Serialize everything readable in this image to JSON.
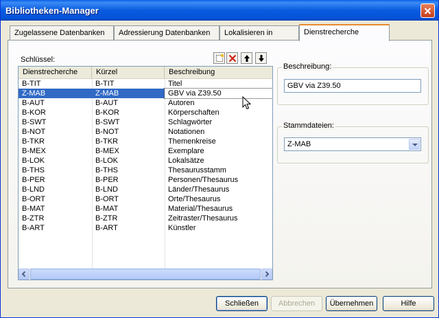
{
  "window": {
    "title": "Bibliotheken-Manager"
  },
  "tabs": [
    {
      "label": "Zugelassene Datenbanken",
      "active": false
    },
    {
      "label": "Adressierung Datenbanken",
      "active": false
    },
    {
      "label": "Lokalisieren in",
      "active": false
    },
    {
      "label": "Dienstrecherche",
      "active": true
    }
  ],
  "list": {
    "label": "Schlüssel:",
    "columns": [
      "Dienstrecherche",
      "Kürzel",
      "Beschreibung"
    ],
    "selected_index": 1,
    "rows": [
      [
        "B-TIT",
        "B-TIT",
        "Titel"
      ],
      [
        "Z-MAB",
        "Z-MAB",
        "GBV via Z39.50"
      ],
      [
        "B-AUT",
        "B-AUT",
        "Autoren"
      ],
      [
        "B-KOR",
        "B-KOR",
        "Körperschaften"
      ],
      [
        "B-SWT",
        "B-SWT",
        "Schlagwörter"
      ],
      [
        "B-NOT",
        "B-NOT",
        "Notationen"
      ],
      [
        "B-TKR",
        "B-TKR",
        "Themenkreise"
      ],
      [
        "B-MEX",
        "B-MEX",
        "Exemplare"
      ],
      [
        "B-LOK",
        "B-LOK",
        "Lokalsätze"
      ],
      [
        "B-THS",
        "B-THS",
        "Thesaurusstamm"
      ],
      [
        "B-PER",
        "B-PER",
        "Personen/Thesaurus"
      ],
      [
        "B-LND",
        "B-LND",
        "Länder/Thesaurus"
      ],
      [
        "B-ORT",
        "B-ORT",
        "Orte/Thesaurus"
      ],
      [
        "B-MAT",
        "B-MAT",
        "Material/Thesaurus"
      ],
      [
        "B-ZTR",
        "B-ZTR",
        "Zeitraster/Thesaurus"
      ],
      [
        "B-ART",
        "B-ART",
        "Künstler"
      ]
    ]
  },
  "toolbar": {
    "icons": [
      "new-icon",
      "delete-icon",
      "move-up-icon",
      "move-down-icon"
    ]
  },
  "beschreibung": {
    "legend": "Beschreibung:",
    "value": "GBV via Z39.50"
  },
  "stammdateien": {
    "legend": "Stammdateien:",
    "value": "Z-MAB"
  },
  "buttons": {
    "close": "Schließen",
    "cancel": "Abbrechen",
    "apply": "Übernehmen",
    "help": "Hilfe"
  },
  "colors": {
    "title_bar": "#0a5be0",
    "selection": "#316ac5",
    "active_tab_accent": "#e68b2c"
  }
}
